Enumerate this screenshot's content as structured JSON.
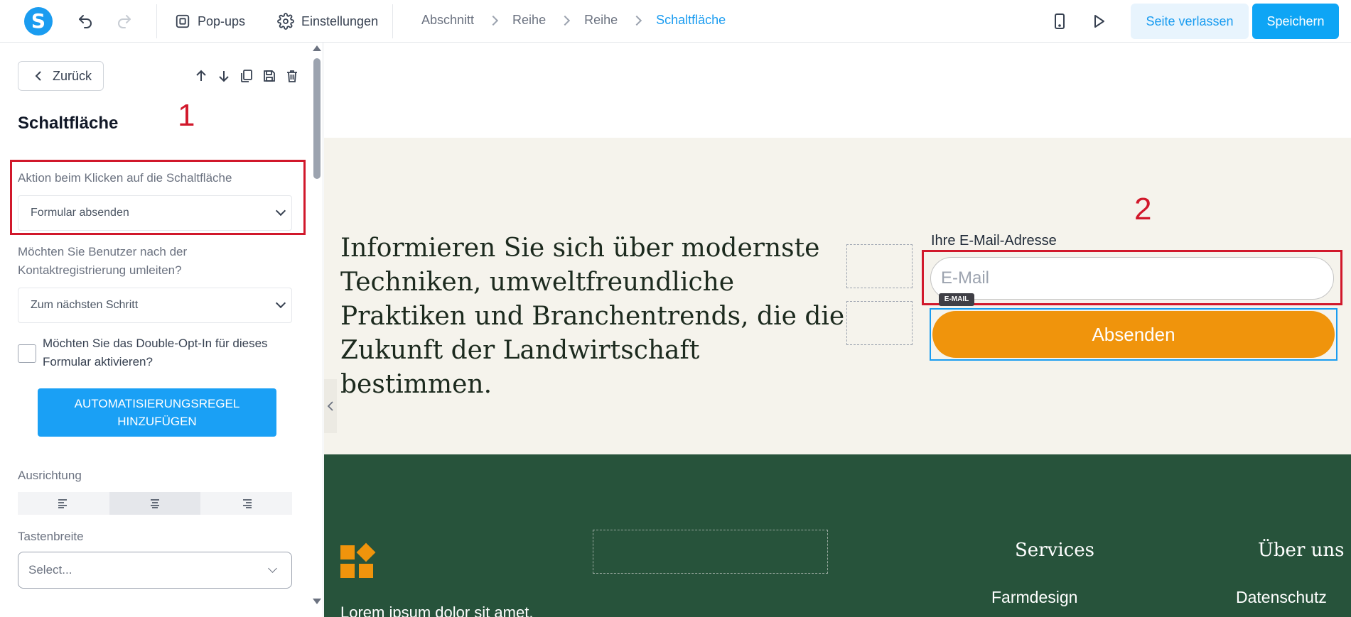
{
  "topbar": {
    "logo_letter": "S",
    "popups_label": "Pop-ups",
    "settings_label": "Einstellungen",
    "breadcrumbs": [
      "Abschnitt",
      "Reihe",
      "Reihe",
      "Schaltfläche"
    ],
    "leave_label": "Seite verlassen",
    "save_label": "Speichern"
  },
  "panel": {
    "back_label": "Zurück",
    "title": "Schaltfläche",
    "marker1": "1",
    "action_label": "Aktion beim Klicken auf die Schaltfläche",
    "action_value": "Formular absenden",
    "redirect_label": "Möchten Sie Benutzer nach der Kontaktregistrierung umleiten?",
    "redirect_value": "Zum nächsten Schritt",
    "double_opt_in_label": "Möchten Sie das Double-Opt-In für dieses Formular aktivieren?",
    "automation_button": "AUTOMATISIERUNGSREGEL HINZUFÜGEN",
    "alignment_label": "Ausrichtung",
    "alignment_selected": "center",
    "width_label": "Tastenbreite",
    "width_placeholder": "Select..."
  },
  "canvas": {
    "marker2": "2",
    "headline": "Informieren Sie sich über modernste Techniken, umweltfreundliche Praktiken und Branchentrends, die die Zukunft der Landwirtschaft bestimmen.",
    "email_label": "Ihre E-Mail-Adresse",
    "email_placeholder": "E-Mail",
    "email_badge": "E-MAIL",
    "submit_label": "Absenden",
    "footer": {
      "text": "Lorem ipsum dolor sit amet,",
      "services_heading": "Services",
      "services_link": "Farmdesign",
      "about_heading": "Über uns",
      "about_link": "Datenschutz"
    }
  },
  "colors": {
    "accent": "#1a9cf0",
    "highlight": "#d1182b",
    "submit": "#f0940c",
    "footer_bg": "#27533b",
    "section_bg": "#f5f3ec"
  }
}
